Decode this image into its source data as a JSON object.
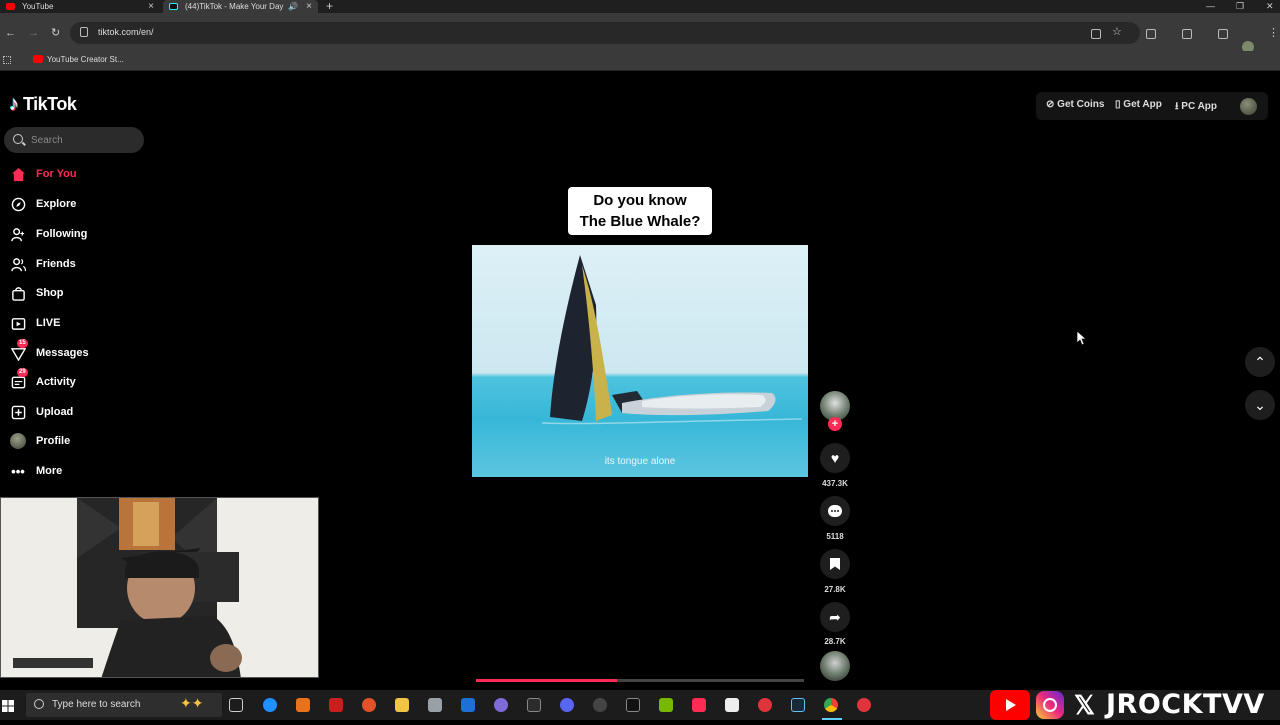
{
  "browser": {
    "tabs": [
      {
        "title": "YouTube"
      },
      {
        "title": "(44)TikTok - Make Your Day"
      }
    ],
    "url": "tiktok.com/en/",
    "bookmark": "YouTube Creator St..."
  },
  "tiktok": {
    "brand": "TikTok",
    "search_placeholder": "Search",
    "nav": [
      {
        "label": "For You",
        "icon": "home-icon"
      },
      {
        "label": "Explore",
        "icon": "compass-icon"
      },
      {
        "label": "Following",
        "icon": "following-icon"
      },
      {
        "label": "Friends",
        "icon": "friends-icon"
      },
      {
        "label": "Shop",
        "icon": "shop-icon"
      },
      {
        "label": "LIVE",
        "icon": "live-icon"
      },
      {
        "label": "Messages",
        "icon": "messages-icon",
        "badge": "15"
      },
      {
        "label": "Activity",
        "icon": "activity-icon",
        "badge": "29"
      },
      {
        "label": "Upload",
        "icon": "upload-icon"
      },
      {
        "label": "Profile",
        "icon": "profile-avatar"
      },
      {
        "label": "More",
        "icon": "more-icon"
      }
    ],
    "header": {
      "get_coins": "Get Coins",
      "get_app": "Get App",
      "pc_app": "PC App"
    },
    "video": {
      "caption_line1": "Do you know",
      "caption_line2": "The Blue Whale?",
      "subtitle": "its tongue alone",
      "progress": 0.43
    },
    "actions": {
      "likes": "437.3K",
      "comments": "5118",
      "saves": "27.8K",
      "shares": "28.7K"
    }
  },
  "taskbar": {
    "search_placeholder": "Type here to search"
  },
  "watermark": "JROCKTVV",
  "colors": {
    "accent": "#fe2c55",
    "background": "#000000"
  }
}
